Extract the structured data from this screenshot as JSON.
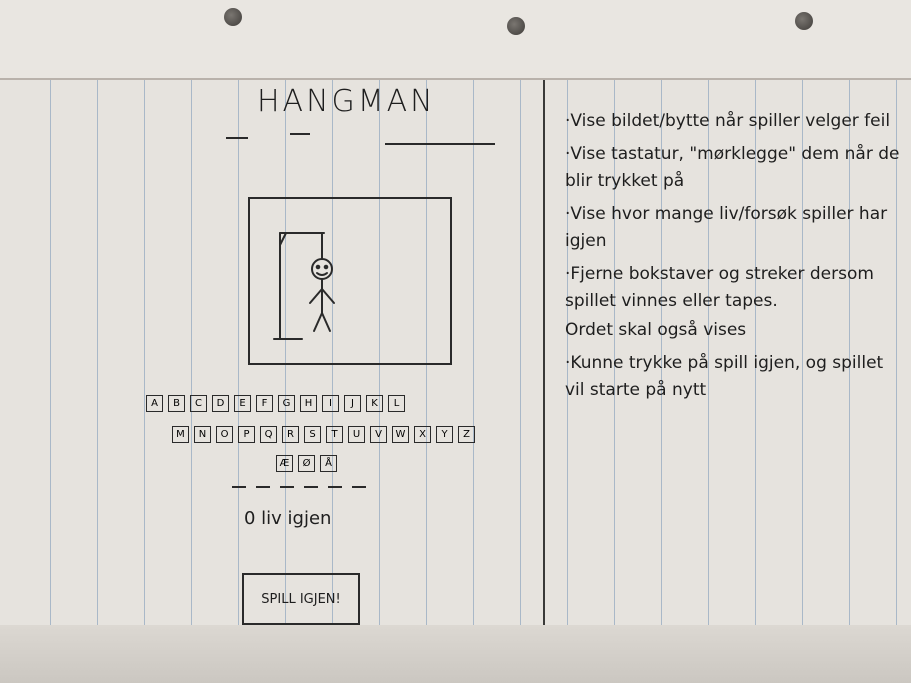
{
  "sketch": {
    "title": "HANGMAN",
    "letters_row1": [
      "A",
      "B",
      "C",
      "D",
      "E",
      "F",
      "G",
      "H",
      "I",
      "J",
      "K",
      "L"
    ],
    "letters_row2": [
      "M",
      "N",
      "O",
      "P",
      "Q",
      "R",
      "S",
      "T",
      "U",
      "V",
      "W",
      "X",
      "Y",
      "Z"
    ],
    "letters_row3": [
      "Æ",
      "Ø",
      "Å"
    ],
    "lives_text": "0 liv igjen",
    "button_label": "SPILL IGJEN!"
  },
  "notes": [
    "·Vise bildet/bytte når spiller velger feil",
    "·Vise tastatur, \"mørklegge\" dem når de blir trykket på",
    "·Vise hvor mange liv/forsøk spiller har igjen",
    "·Fjerne bokstaver og streker dersom spillet vinnes eller tapes.",
    "Ordet skal også vises",
    "·Kunne trykke på spill igjen, og spillet vil starte på nytt"
  ]
}
